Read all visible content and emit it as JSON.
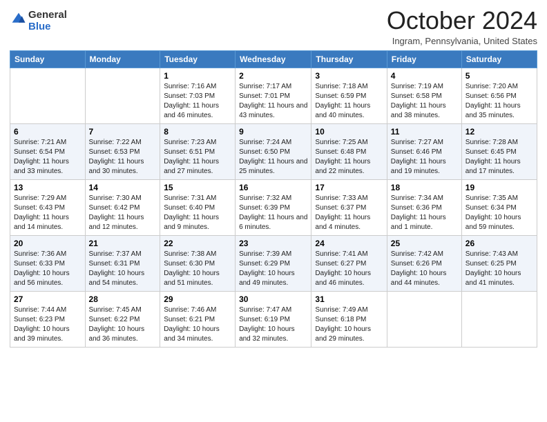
{
  "header": {
    "logo_general": "General",
    "logo_blue": "Blue",
    "month_title": "October 2024",
    "location": "Ingram, Pennsylvania, United States"
  },
  "days_of_week": [
    "Sunday",
    "Monday",
    "Tuesday",
    "Wednesday",
    "Thursday",
    "Friday",
    "Saturday"
  ],
  "weeks": [
    [
      {
        "day": "",
        "info": ""
      },
      {
        "day": "",
        "info": ""
      },
      {
        "day": "1",
        "info": "Sunrise: 7:16 AM\nSunset: 7:03 PM\nDaylight: 11 hours and 46 minutes."
      },
      {
        "day": "2",
        "info": "Sunrise: 7:17 AM\nSunset: 7:01 PM\nDaylight: 11 hours and 43 minutes."
      },
      {
        "day": "3",
        "info": "Sunrise: 7:18 AM\nSunset: 6:59 PM\nDaylight: 11 hours and 40 minutes."
      },
      {
        "day": "4",
        "info": "Sunrise: 7:19 AM\nSunset: 6:58 PM\nDaylight: 11 hours and 38 minutes."
      },
      {
        "day": "5",
        "info": "Sunrise: 7:20 AM\nSunset: 6:56 PM\nDaylight: 11 hours and 35 minutes."
      }
    ],
    [
      {
        "day": "6",
        "info": "Sunrise: 7:21 AM\nSunset: 6:54 PM\nDaylight: 11 hours and 33 minutes."
      },
      {
        "day": "7",
        "info": "Sunrise: 7:22 AM\nSunset: 6:53 PM\nDaylight: 11 hours and 30 minutes."
      },
      {
        "day": "8",
        "info": "Sunrise: 7:23 AM\nSunset: 6:51 PM\nDaylight: 11 hours and 27 minutes."
      },
      {
        "day": "9",
        "info": "Sunrise: 7:24 AM\nSunset: 6:50 PM\nDaylight: 11 hours and 25 minutes."
      },
      {
        "day": "10",
        "info": "Sunrise: 7:25 AM\nSunset: 6:48 PM\nDaylight: 11 hours and 22 minutes."
      },
      {
        "day": "11",
        "info": "Sunrise: 7:27 AM\nSunset: 6:46 PM\nDaylight: 11 hours and 19 minutes."
      },
      {
        "day": "12",
        "info": "Sunrise: 7:28 AM\nSunset: 6:45 PM\nDaylight: 11 hours and 17 minutes."
      }
    ],
    [
      {
        "day": "13",
        "info": "Sunrise: 7:29 AM\nSunset: 6:43 PM\nDaylight: 11 hours and 14 minutes."
      },
      {
        "day": "14",
        "info": "Sunrise: 7:30 AM\nSunset: 6:42 PM\nDaylight: 11 hours and 12 minutes."
      },
      {
        "day": "15",
        "info": "Sunrise: 7:31 AM\nSunset: 6:40 PM\nDaylight: 11 hours and 9 minutes."
      },
      {
        "day": "16",
        "info": "Sunrise: 7:32 AM\nSunset: 6:39 PM\nDaylight: 11 hours and 6 minutes."
      },
      {
        "day": "17",
        "info": "Sunrise: 7:33 AM\nSunset: 6:37 PM\nDaylight: 11 hours and 4 minutes."
      },
      {
        "day": "18",
        "info": "Sunrise: 7:34 AM\nSunset: 6:36 PM\nDaylight: 11 hours and 1 minute."
      },
      {
        "day": "19",
        "info": "Sunrise: 7:35 AM\nSunset: 6:34 PM\nDaylight: 10 hours and 59 minutes."
      }
    ],
    [
      {
        "day": "20",
        "info": "Sunrise: 7:36 AM\nSunset: 6:33 PM\nDaylight: 10 hours and 56 minutes."
      },
      {
        "day": "21",
        "info": "Sunrise: 7:37 AM\nSunset: 6:31 PM\nDaylight: 10 hours and 54 minutes."
      },
      {
        "day": "22",
        "info": "Sunrise: 7:38 AM\nSunset: 6:30 PM\nDaylight: 10 hours and 51 minutes."
      },
      {
        "day": "23",
        "info": "Sunrise: 7:39 AM\nSunset: 6:29 PM\nDaylight: 10 hours and 49 minutes."
      },
      {
        "day": "24",
        "info": "Sunrise: 7:41 AM\nSunset: 6:27 PM\nDaylight: 10 hours and 46 minutes."
      },
      {
        "day": "25",
        "info": "Sunrise: 7:42 AM\nSunset: 6:26 PM\nDaylight: 10 hours and 44 minutes."
      },
      {
        "day": "26",
        "info": "Sunrise: 7:43 AM\nSunset: 6:25 PM\nDaylight: 10 hours and 41 minutes."
      }
    ],
    [
      {
        "day": "27",
        "info": "Sunrise: 7:44 AM\nSunset: 6:23 PM\nDaylight: 10 hours and 39 minutes."
      },
      {
        "day": "28",
        "info": "Sunrise: 7:45 AM\nSunset: 6:22 PM\nDaylight: 10 hours and 36 minutes."
      },
      {
        "day": "29",
        "info": "Sunrise: 7:46 AM\nSunset: 6:21 PM\nDaylight: 10 hours and 34 minutes."
      },
      {
        "day": "30",
        "info": "Sunrise: 7:47 AM\nSunset: 6:19 PM\nDaylight: 10 hours and 32 minutes."
      },
      {
        "day": "31",
        "info": "Sunrise: 7:49 AM\nSunset: 6:18 PM\nDaylight: 10 hours and 29 minutes."
      },
      {
        "day": "",
        "info": ""
      },
      {
        "day": "",
        "info": ""
      }
    ]
  ]
}
